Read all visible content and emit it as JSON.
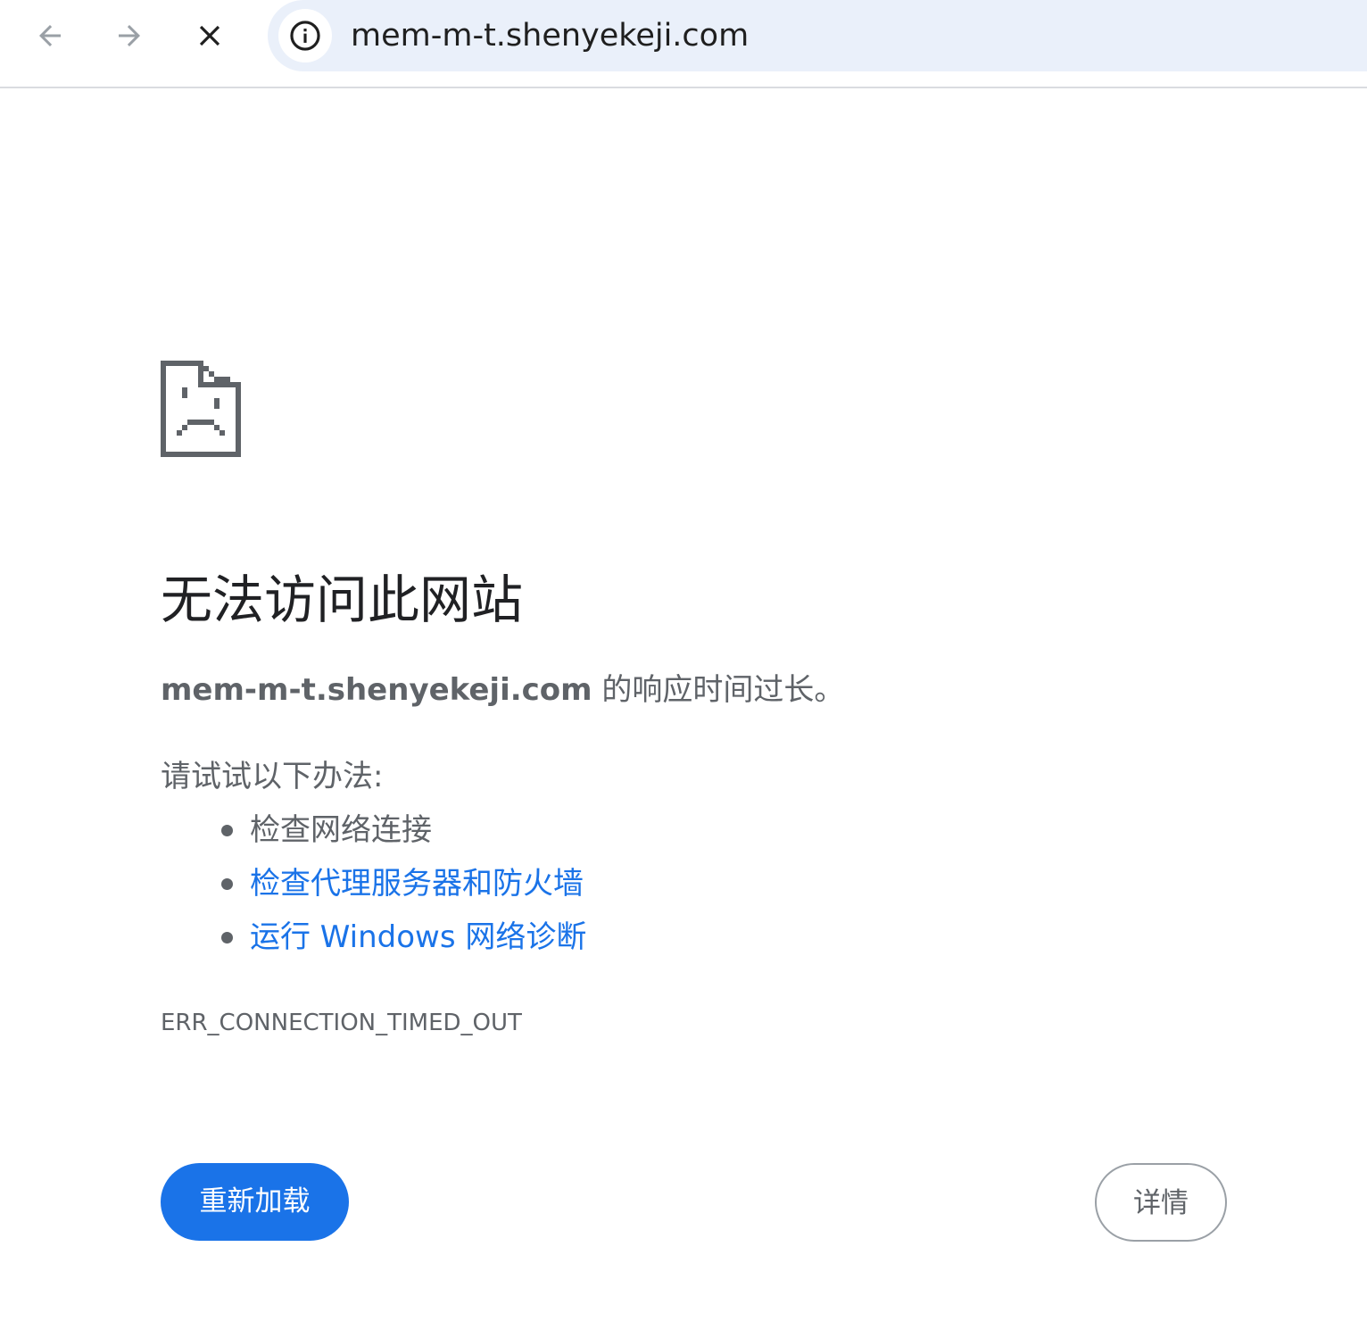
{
  "toolbar": {
    "back_icon": "arrow-left-icon",
    "forward_icon": "arrow-right-icon",
    "stop_icon": "close-icon",
    "site_info_icon": "info-circle-icon",
    "url": "mem-m-t.shenyekeji.com"
  },
  "error_page": {
    "icon": "sad-page-icon",
    "title": "无法访问此网站",
    "host": "mem-m-t.shenyekeji.com",
    "summary_suffix": " 的响应时间过长。",
    "suggestions_heading": "请试试以下办法:",
    "suggestions": [
      {
        "label": "检查网络连接",
        "is_link": false
      },
      {
        "label": "检查代理服务器和防火墙",
        "is_link": true
      },
      {
        "label": "运行 Windows 网络诊断",
        "is_link": true
      }
    ],
    "error_code": "ERR_CONNECTION_TIMED_OUT",
    "reload_label": "重新加载",
    "details_label": "详情"
  },
  "colors": {
    "accent": "#1a73e8",
    "text_primary": "#202124",
    "text_secondary": "#5f6368",
    "omnibox_bg": "#eaf0fa"
  }
}
